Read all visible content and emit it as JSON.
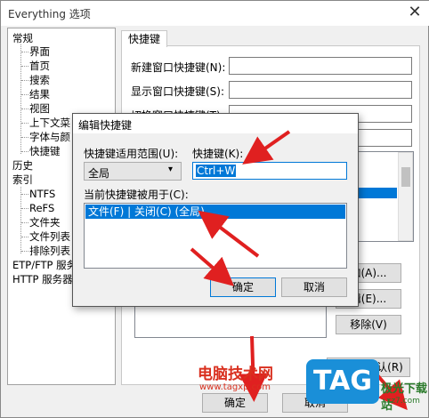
{
  "window": {
    "title": "Everything 选项"
  },
  "tree": {
    "items": [
      {
        "label": "常规",
        "level": 0
      },
      {
        "label": "界面",
        "level": 1
      },
      {
        "label": "首页",
        "level": 1
      },
      {
        "label": "搜索",
        "level": 1
      },
      {
        "label": "结果",
        "level": 1
      },
      {
        "label": "视图",
        "level": 1
      },
      {
        "label": "上下文菜",
        "level": 1
      },
      {
        "label": "字体与颜",
        "level": 1
      },
      {
        "label": "快捷键",
        "level": 1
      },
      {
        "label": "历史",
        "level": 0
      },
      {
        "label": "索引",
        "level": 0
      },
      {
        "label": "NTFS",
        "level": 1
      },
      {
        "label": "ReFS",
        "level": 1
      },
      {
        "label": "文件夹",
        "level": 1
      },
      {
        "label": "文件列表",
        "level": 1
      },
      {
        "label": "排除列表",
        "level": 1
      },
      {
        "label": "ETP/FTP 服务",
        "level": 0
      },
      {
        "label": "HTTP 服务器",
        "level": 0
      }
    ]
  },
  "tab": {
    "label": "快捷键"
  },
  "fields": {
    "new_window": "新建窗口快捷键(N):",
    "show_window": "显示窗口快捷键(S):",
    "toggle_window": "切换窗口快捷键(T):"
  },
  "right_buttons": {
    "add": "加(A)...",
    "edit": "辑(E)...",
    "remove": "移除(V)",
    "restore": "恢复到默认(R)"
  },
  "bottom_buttons": {
    "ok": "确定",
    "cancel": "取消"
  },
  "dialog": {
    "title": "编辑快捷键",
    "scope_label": "快捷键适用范围(U):",
    "scope_value": "全局",
    "hotkey_label": "快捷键(K):",
    "hotkey_value": "Ctrl+W",
    "used_for_label": "当前快捷键被用于(C):",
    "used_for_items": [
      "文件(F) | 关闭(C) (全局)"
    ],
    "ok": "确定",
    "cancel": "取消"
  },
  "watermark": {
    "brand": "电脑技术网",
    "url": "www.tagxp.com",
    "logo": "TAG",
    "site": "极光下载站",
    "site_url": "xz7.com"
  },
  "colors": {
    "selection": "#0078d7",
    "arrow": "#e02020",
    "logo_bg": "#1a8fd8"
  }
}
